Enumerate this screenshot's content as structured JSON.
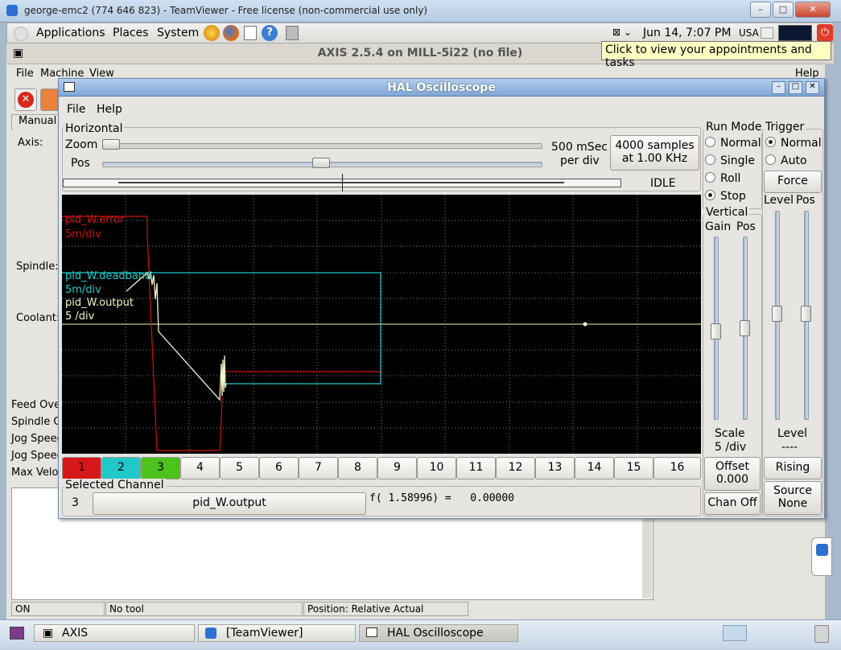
{
  "teamviewer": {
    "title": "george-emc2 (774 646 823) - TeamViewer - Free license (non-commercial use only)"
  },
  "panel": {
    "menus": [
      "Applications",
      "Places",
      "System"
    ],
    "clock": "Jun 14,  7:07 PM",
    "locale": "USA"
  },
  "tooltip": "Click to view your appointments and tasks",
  "axis": {
    "title": "AXIS 2.5.4 on MILL-5i22 (no file)",
    "menus": [
      "File",
      "Machine",
      "View"
    ],
    "help": "Help",
    "tab_manual": "Manual",
    "labels": {
      "axis": "Axis:",
      "spindle": "Spindle:",
      "coolant": "Coolant:"
    },
    "overrides": [
      "Feed Ove",
      "Spindle O",
      "Jog Speed",
      "Jog Speed",
      "Max Veloc"
    ],
    "status": {
      "state": "ON",
      "tool": "No tool",
      "position": "Position: Relative Actual"
    }
  },
  "scope": {
    "title": "HAL Oscilloscope",
    "menus": [
      "File",
      "Help"
    ],
    "horizontal": {
      "label": "Horizontal",
      "zoom_label": "Zoom",
      "pos_label": "Pos",
      "rate_line1": "500 mSec",
      "rate_line2": "per div",
      "samples_line1": "4000 samples",
      "samples_line2": "at 1.00 KHz",
      "state": "IDLE"
    },
    "run_mode": {
      "label": "Run Mode",
      "options": [
        "Normal",
        "Single",
        "Roll",
        "Stop"
      ],
      "selected": "Stop"
    },
    "trigger": {
      "label": "Trigger",
      "options": [
        "Normal",
        "Auto"
      ],
      "selected": "Normal",
      "force": "Force",
      "level_label": "Level",
      "pos_label": "Pos",
      "level_title": "Level",
      "level_value": "----",
      "edge": "Rising",
      "source_line1": "Source",
      "source_line2": "None"
    },
    "vertical": {
      "label": "Vertical",
      "gain_label": "Gain",
      "pos_label": "Pos",
      "scale_title": "Scale",
      "scale_value": "5 /div",
      "offset_line1": "Offset",
      "offset_line2": "0.000",
      "chan_off": "Chan Off"
    },
    "traces": [
      {
        "name": "pid_W.error",
        "scale": "5m/div",
        "color": "#d01010"
      },
      {
        "name": "pid_W.deadband",
        "scale": "5m/div",
        "color": "#20c8c8"
      },
      {
        "name": "pid_W.output",
        "scale": "5 /div",
        "color": "#f4f4c8"
      }
    ],
    "channels": [
      "1",
      "2",
      "3",
      "4",
      "5",
      "6",
      "7",
      "8",
      "9",
      "10",
      "11",
      "12",
      "13",
      "14",
      "15",
      "16"
    ],
    "channel_colors": {
      "1": "#d81818",
      "2": "#20c8c8",
      "3": "#4cc21c"
    },
    "selected_channel": {
      "label": "Selected Channel",
      "number": "3",
      "name": "pid_W.output",
      "readout": "f( 1.58996) =   0.00000"
    }
  },
  "taskbar": {
    "tasks": [
      "AXIS",
      "[TeamViewer]",
      "HAL Oscilloscope"
    ]
  }
}
